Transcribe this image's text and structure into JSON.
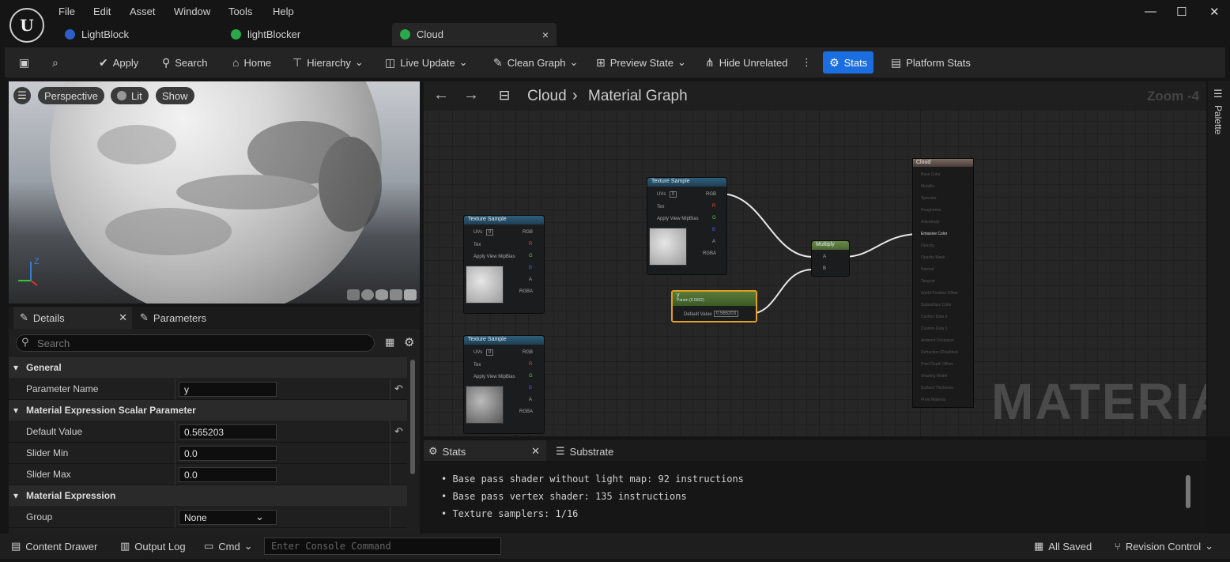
{
  "menu": [
    "File",
    "Edit",
    "Asset",
    "Window",
    "Tools",
    "Help"
  ],
  "tabs": [
    {
      "label": "LightBlock",
      "color": "#2c5ec7"
    },
    {
      "label": "lightBlocker",
      "color": "#2aa84a"
    },
    {
      "label": "Cloud",
      "color": "#2aa84a",
      "close": "×"
    }
  ],
  "window_controls": [
    "—",
    "☐",
    "✕"
  ],
  "toolbar": {
    "apply": "Apply",
    "search": "Search",
    "home": "Home",
    "hierarchy": "Hierarchy",
    "live_update": "Live Update",
    "clean_graph": "Clean Graph",
    "preview_state": "Preview State",
    "hide_unrelated": "Hide Unrelated",
    "stats": "Stats",
    "platform_stats": "Platform Stats"
  },
  "viewport": {
    "perspective": "Perspective",
    "lit": "Lit",
    "show": "Show",
    "axis_z": "Z"
  },
  "details": {
    "tab_details": "Details",
    "tab_parameters": "Parameters",
    "search_placeholder": "Search",
    "cat_general": "General",
    "param_name_label": "Parameter Name",
    "param_name_value": "y",
    "cat_scalar": "Material Expression Scalar Parameter",
    "default_label": "Default Value",
    "default_value": "0.565203",
    "slider_min_label": "Slider Min",
    "slider_min_value": "0.0",
    "slider_max_label": "Slider Max",
    "slider_max_value": "0.0",
    "cat_expression": "Material Expression",
    "group_label": "Group",
    "group_value": "None"
  },
  "graph": {
    "breadcrumb_asset": "Cloud",
    "breadcrumb_sep": "›",
    "breadcrumb_graph": "Material Graph",
    "zoom": "Zoom -4",
    "watermark": "MATERIAL",
    "tex_node_title": "Texture Sample",
    "uvs": "UVs",
    "zero": "0",
    "tex": "Tex",
    "apply_mip": "Apply View MipBias",
    "rgb": "RGB",
    "r": "R",
    "g": "G",
    "b": "B",
    "a": "A",
    "rgba": "RGBA",
    "multiply": "Multiply",
    "pin_a": "A",
    "pin_b": "B",
    "param_title": "y",
    "param_sub": "Param (0.5652)",
    "param_default_label": "Default Value",
    "param_default_value": "0.565203",
    "result_title": "Cloud",
    "result_pins": [
      "Base Color",
      "Metallic",
      "Specular",
      "Roughness",
      "Anisotropy",
      "Emissive Color",
      "Opacity",
      "Opacity Mask",
      "Normal",
      "Tangent",
      "World Position Offset",
      "Subsurface Color",
      "Custom Data 0",
      "Custom Data 1",
      "Ambient Occlusion",
      "Refraction (Disabled)",
      "Pixel Depth Offset",
      "Shading Model",
      "Surface Thickness",
      "Front Material"
    ]
  },
  "palette_label": "Palette",
  "stats": {
    "tab_stats": "Stats",
    "tab_substrate": "Substrate",
    "lines": [
      "Base pass shader without light map: 92 instructions",
      "Base pass vertex shader: 135 instructions",
      "Texture samplers: 1/16"
    ]
  },
  "statusbar": {
    "content_drawer": "Content Drawer",
    "output_log": "Output Log",
    "cmd": "Cmd",
    "console_placeholder": "Enter Console Command",
    "all_saved": "All Saved",
    "revision_control": "Revision Control"
  }
}
